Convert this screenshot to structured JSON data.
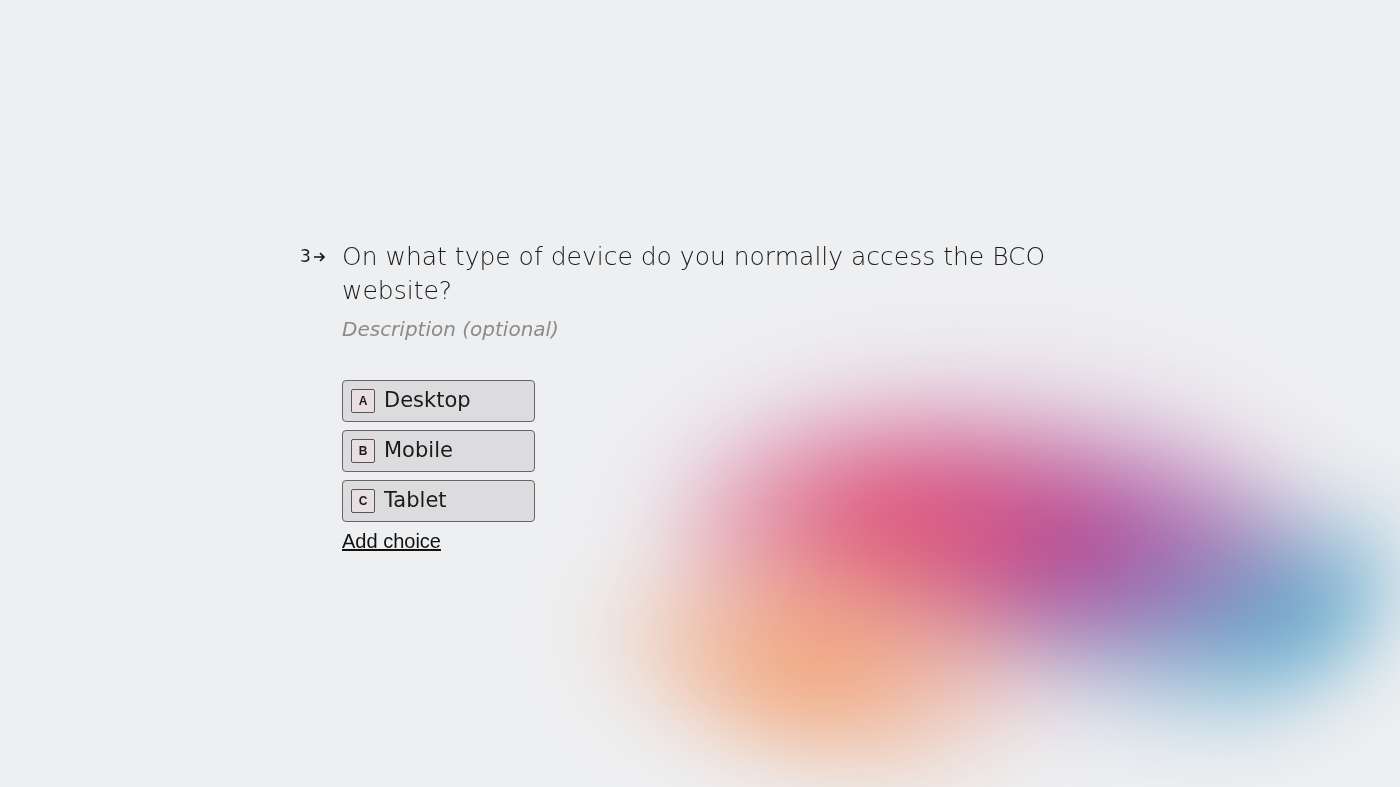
{
  "question": {
    "number": "3",
    "text": "On what type of device do you normally access the BCO website?"
  },
  "description": {
    "placeholder": "Description (optional)"
  },
  "choices": [
    {
      "key": "A",
      "label": "Desktop"
    },
    {
      "key": "B",
      "label": "Mobile"
    },
    {
      "key": "C",
      "label": "Tablet"
    }
  ],
  "add_choice": "Add choice"
}
